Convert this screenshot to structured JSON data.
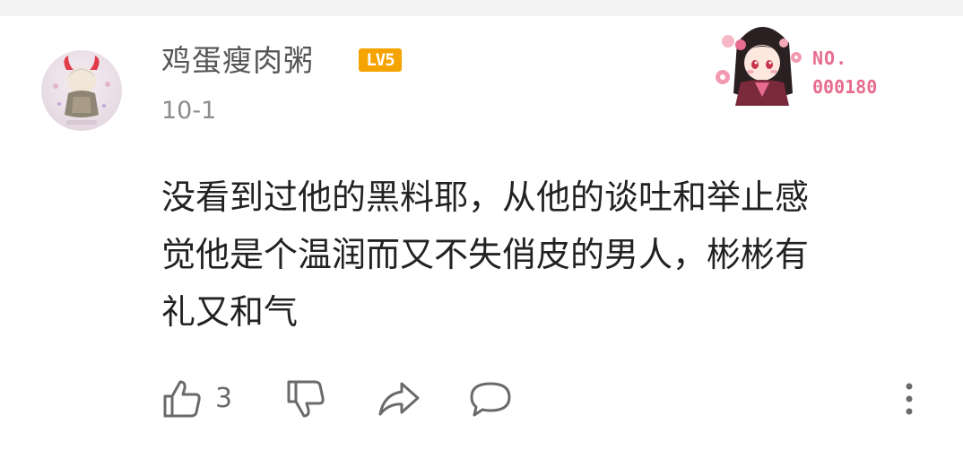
{
  "comment": {
    "username": "鸡蛋瘦肉粥",
    "level": "LV5",
    "date": "10-1",
    "fan_badge": {
      "label": "NO.",
      "number": "000180"
    },
    "text_lines": [
      "没看到过他的黑料耶，从他的谈吐和举止感",
      "觉他是个温润而又不失俏皮的男人，彬彬有",
      "礼又和气"
    ],
    "actions": {
      "like_count": "3",
      "like_icon": "thumbs-up-icon",
      "dislike_icon": "thumbs-down-icon",
      "share_icon": "share-icon",
      "reply_icon": "comment-icon",
      "more_icon": "more-vertical-icon"
    }
  },
  "colors": {
    "username": "#555555",
    "level_badge": "#f5a300",
    "fan_badge": "#e86c8f",
    "text": "#222222",
    "icon": "#6a6a6a"
  }
}
